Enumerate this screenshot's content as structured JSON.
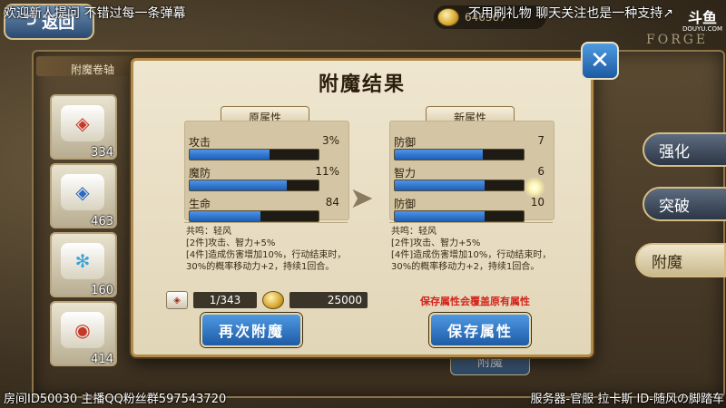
{
  "overlay": {
    "danmu_left": "欢迎新人提问 不错过每一条弹幕",
    "danmu_right": "不用刷礼物 聊天关注也是一种支持↗",
    "footer_left": "房间ID50030 主播QQ粉丝群597543720",
    "footer_right": "服务器-官服 拉卡斯 ID-随风の脚踏车",
    "brand_top": "斗鱼",
    "brand_bottom": "DOUYU.COM"
  },
  "header": {
    "back_label": "返回",
    "gold": "646367",
    "forge_logo": "FORGE"
  },
  "background": {
    "tab_label": "附魔卷轴",
    "scroll_counts": [
      "334",
      "463",
      "160",
      "414"
    ],
    "side_buttons": [
      {
        "label": "强化",
        "active": false
      },
      {
        "label": "突破",
        "active": false
      },
      {
        "label": "附魔",
        "active": true
      }
    ],
    "bottom_button": "附魔"
  },
  "modal": {
    "title": "附魔结果",
    "close_label": "✕",
    "original": {
      "label": "原属性",
      "attributes": [
        {
          "name": "攻击",
          "value": "3%",
          "fill": 0.62
        },
        {
          "name": "魔防",
          "value": "11%",
          "fill": 0.75
        },
        {
          "name": "生命",
          "value": "84",
          "fill": 0.55
        }
      ],
      "resonance_title": "共鸣：轻风",
      "resonance_2": "[2件]攻击、智力+5%",
      "resonance_4": "[4件]造成伤害增加10%，行动结束时，30%的概率移动力+2，持续1回合。"
    },
    "new": {
      "label": "新属性",
      "attributes": [
        {
          "name": "防御",
          "value": "7",
          "fill": 0.68
        },
        {
          "name": "智力",
          "value": "6",
          "fill": 0.7
        },
        {
          "name": "防御",
          "value": "10",
          "fill": 0.7
        }
      ],
      "resonance_title": "共鸣：轻风",
      "resonance_2": "[2件]攻击、智力+5%",
      "resonance_4": "[4件]造成伤害增加10%，行动结束时，30%的概率移动力+2，持续1回合。"
    },
    "cost": {
      "scroll_count": "1/343",
      "gold": "25000"
    },
    "warning": "保存属性会覆盖原有属性",
    "reenchant_label": "再次附魔",
    "save_label": "保存属性"
  }
}
